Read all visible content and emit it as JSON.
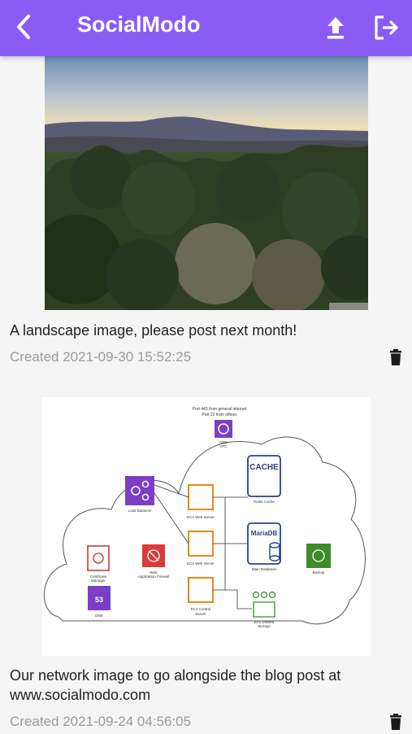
{
  "app": {
    "title": "SocialModo",
    "accent_color": "#8a5cf5",
    "icons": [
      "chevron-left-icon",
      "upload-icon",
      "logout-icon"
    ]
  },
  "posts": [
    {
      "image": "landscape-photo",
      "caption": "A landscape image, please post next month!",
      "created": "Created 2021-09-30 15:52:25"
    },
    {
      "image": "network-diagram",
      "caption": "Our network image to go alongside the blog post at www.socialmodo.com",
      "created": "Created 2021-09-24 04:56:05",
      "diagram": {
        "header": "Port 443 from general internet\nPort 22 from offices",
        "labels": {
          "aws": "AWS\nVPC",
          "lb": "Load Balancer",
          "ec2_1": "EC2 Web Server",
          "ec2_2": "EC2 Web Server",
          "ec2_3": "EC2 Control\nServer",
          "cache_text": "CACHE",
          "cache": "Redis Cache",
          "mariadb_text": "MariaDB",
          "db": "Main Database",
          "cert": "Certificate\nManager",
          "waf": "Web\nApplication Firewall",
          "dns_text": "53",
          "dns": "DNS",
          "backup": "Backup",
          "efs": "EFS Shared\nStorage"
        }
      }
    }
  ]
}
